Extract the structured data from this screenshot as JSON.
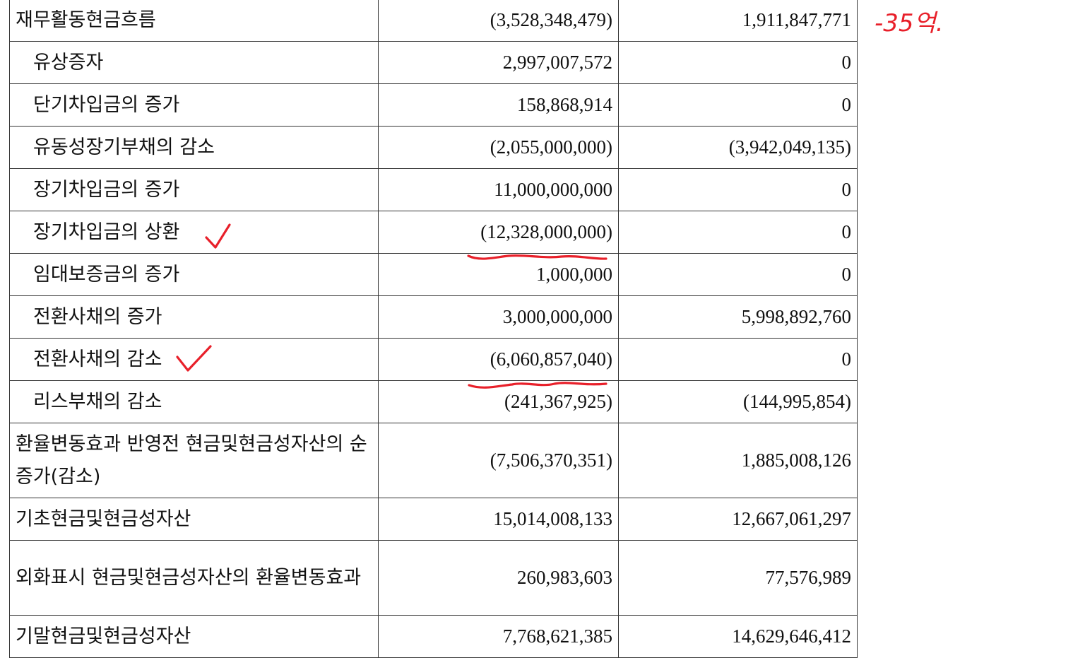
{
  "rows": [
    {
      "label": "재무활동현금흐름",
      "current": "(3,528,348,479)",
      "prior": "1,911,847,771",
      "sub": false,
      "height": 60
    },
    {
      "label": "유상증자",
      "current": "2,997,007,572",
      "prior": "0",
      "sub": true,
      "height": 60
    },
    {
      "label": "단기차입금의 증가",
      "current": "158,868,914",
      "prior": "0",
      "sub": true,
      "height": 60
    },
    {
      "label": "유동성장기부채의 감소",
      "current": "(2,055,000,000)",
      "prior": "(3,942,049,135)",
      "sub": true,
      "height": 60
    },
    {
      "label": "장기차입금의 증가",
      "current": "11,000,000,000",
      "prior": "0",
      "sub": true,
      "height": 60
    },
    {
      "label": "장기차입금의 상환",
      "current": "(12,328,000,000)",
      "prior": "0",
      "sub": true,
      "height": 60
    },
    {
      "label": "임대보증금의 증가",
      "current": "1,000,000",
      "prior": "0",
      "sub": true,
      "height": 60
    },
    {
      "label": "전환사채의 증가",
      "current": "3,000,000,000",
      "prior": "5,998,892,760",
      "sub": true,
      "height": 60
    },
    {
      "label": "전환사채의 감소",
      "current": "(6,060,857,040)",
      "prior": "0",
      "sub": true,
      "height": 60
    },
    {
      "label": "리스부채의 감소",
      "current": "(241,367,925)",
      "prior": "(144,995,854)",
      "sub": true,
      "height": 60
    },
    {
      "label": "환율변동효과 반영전 현금및현금성자산의 순증가(감소)",
      "current": "(7,506,370,351)",
      "prior": "1,885,008,126",
      "sub": false,
      "height": 106
    },
    {
      "label": "기초현금및현금성자산",
      "current": "15,014,008,133",
      "prior": "12,667,061,297",
      "sub": false,
      "height": 60
    },
    {
      "label": "외화표시 현금및현금성자산의 환율변동효과",
      "current": "260,983,603",
      "prior": "77,576,989",
      "sub": false,
      "height": 106
    },
    {
      "label": "기말현금및현금성자산",
      "current": "7,768,621,385",
      "prior": "14,629,646,412",
      "sub": false,
      "height": 60
    }
  ],
  "annotations": {
    "margin_note": "-35억.",
    "ink_color": "#e8202a"
  }
}
